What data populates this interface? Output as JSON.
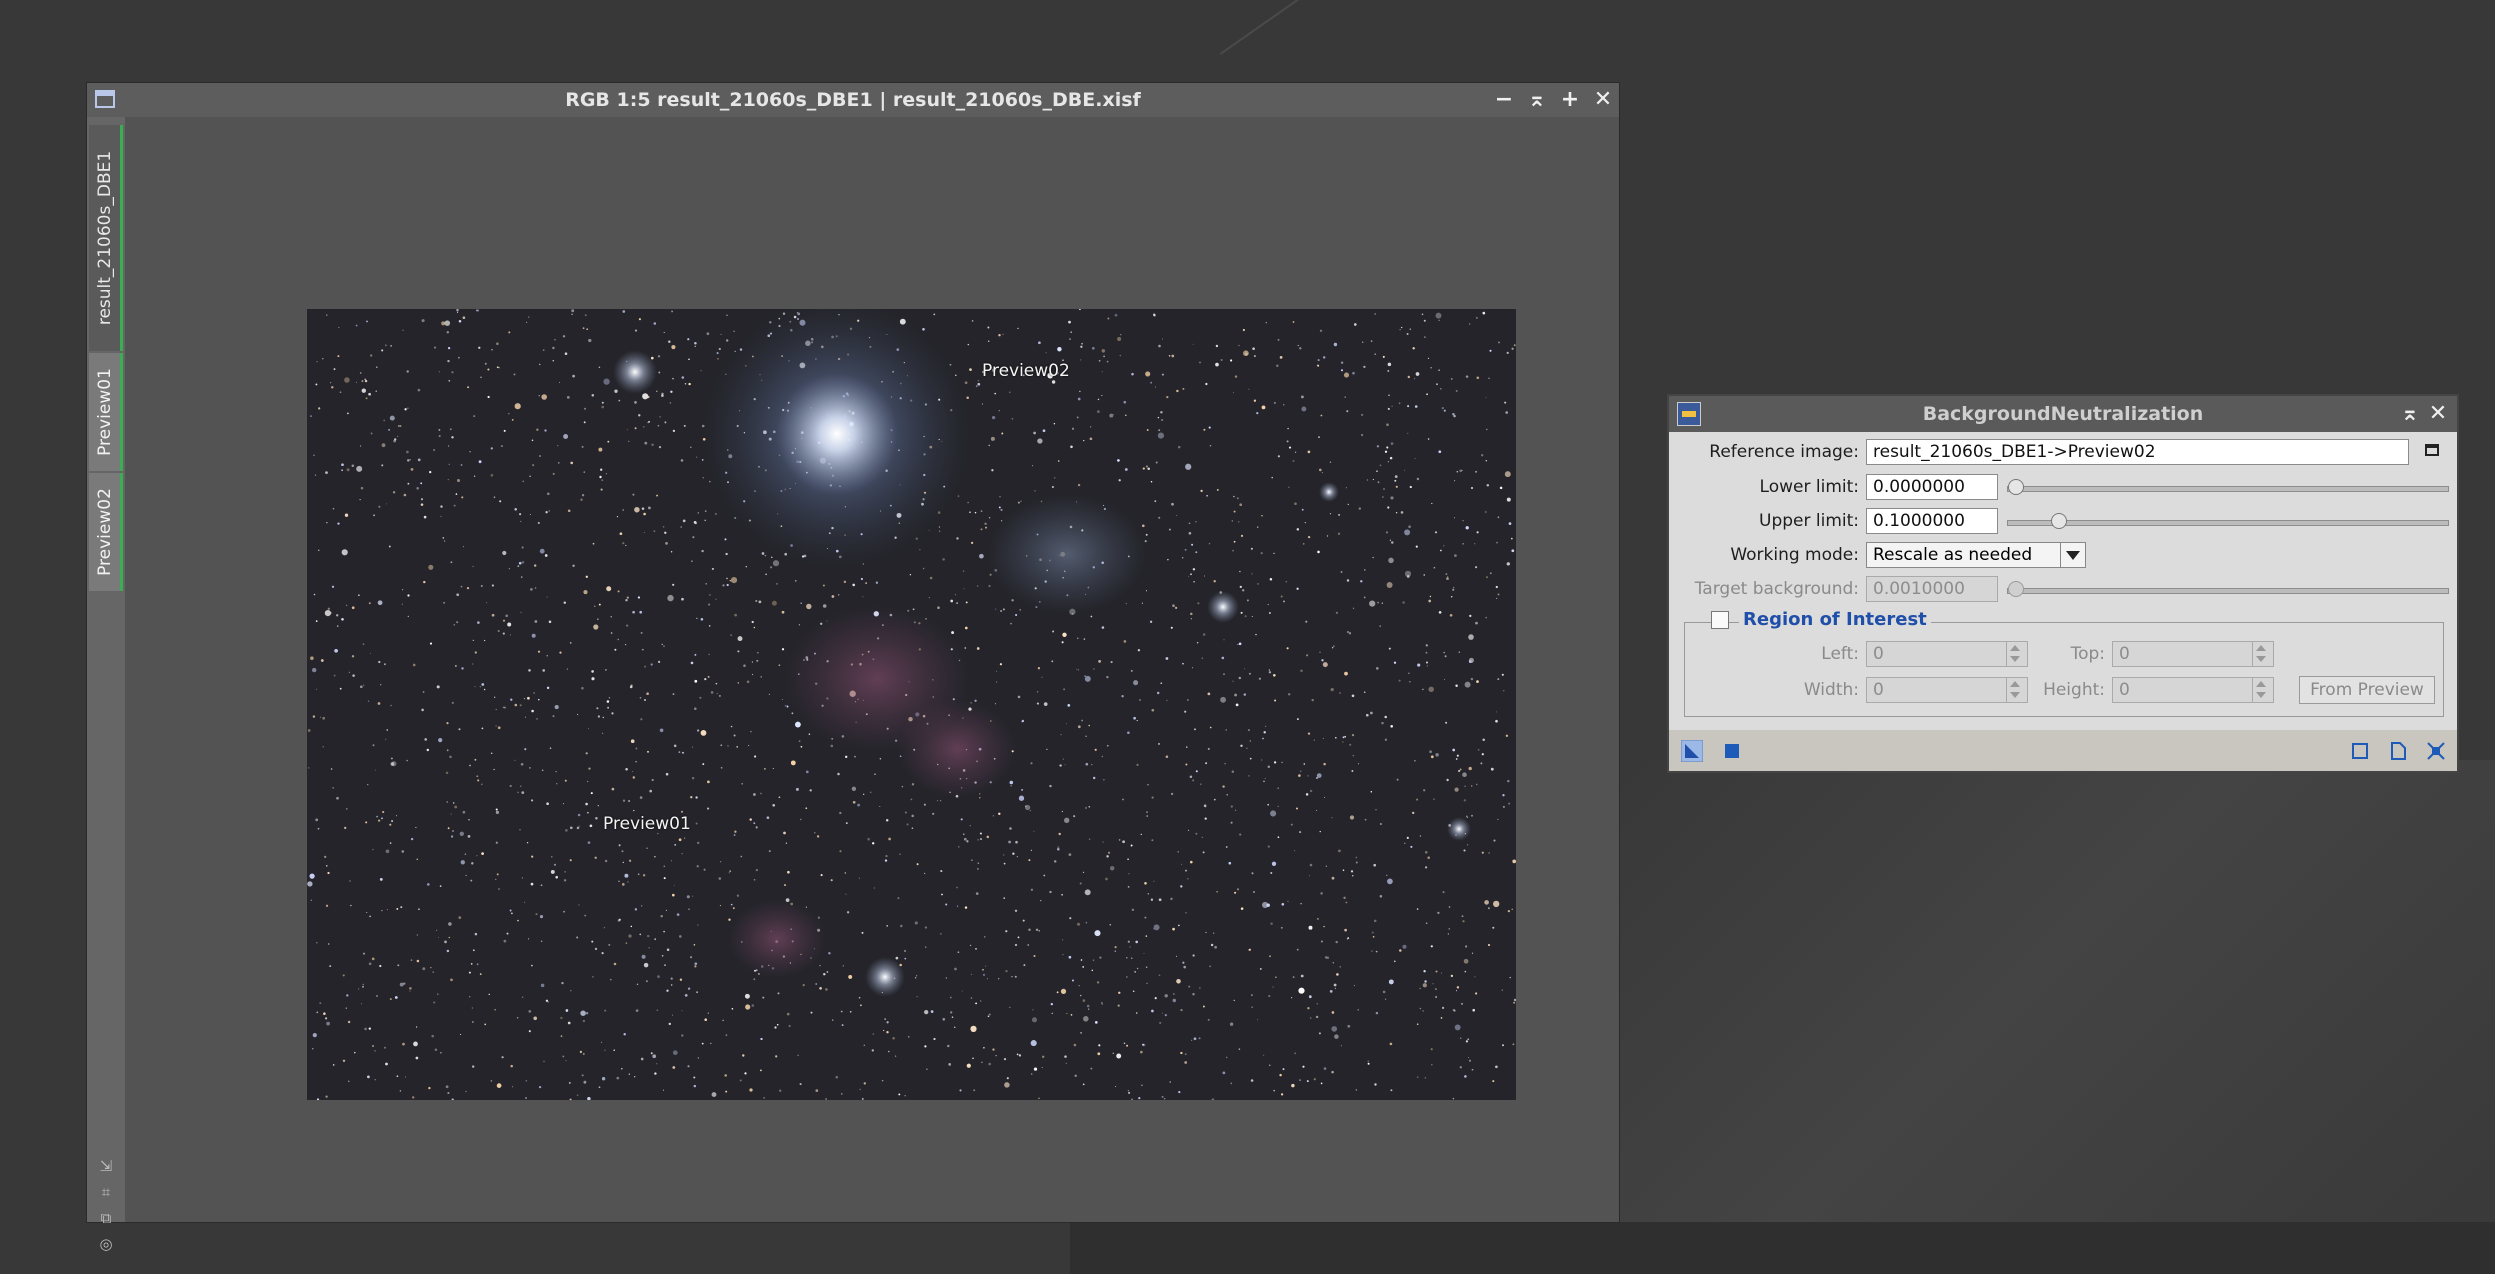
{
  "image_window": {
    "title": "RGB 1:5 result_21060s_DBE1 | result_21060s_DBE.xisf",
    "buttons": {
      "minimize": "−",
      "shade": "⌅",
      "maximize": "+",
      "close": "✕"
    },
    "tabs": [
      "result_21060s_DBE1",
      "Preview01",
      "Preview02"
    ],
    "previews": {
      "p1": "Preview01",
      "p2": "Preview02"
    }
  },
  "dialog": {
    "title": "BackgroundNeutralization",
    "reference_image": {
      "label": "Reference image:",
      "value": "result_21060s_DBE1->Preview02"
    },
    "lower_limit": {
      "label": "Lower limit:",
      "value": "0.0000000"
    },
    "upper_limit": {
      "label": "Upper limit:",
      "value": "0.1000000"
    },
    "working_mode": {
      "label": "Working mode:",
      "value": "Rescale as needed"
    },
    "target_background": {
      "label": "Target background:",
      "value": "0.0010000"
    },
    "roi": {
      "title": "Region of Interest",
      "left": {
        "label": "Left:",
        "value": "0"
      },
      "top": {
        "label": "Top:",
        "value": "0"
      },
      "width": {
        "label": "Width:",
        "value": "0"
      },
      "height": {
        "label": "Height:",
        "value": "0"
      },
      "from_preview": "From Preview"
    }
  },
  "colors": {
    "accent_green": "#38b050",
    "roi_title": "#1f4fa8"
  }
}
